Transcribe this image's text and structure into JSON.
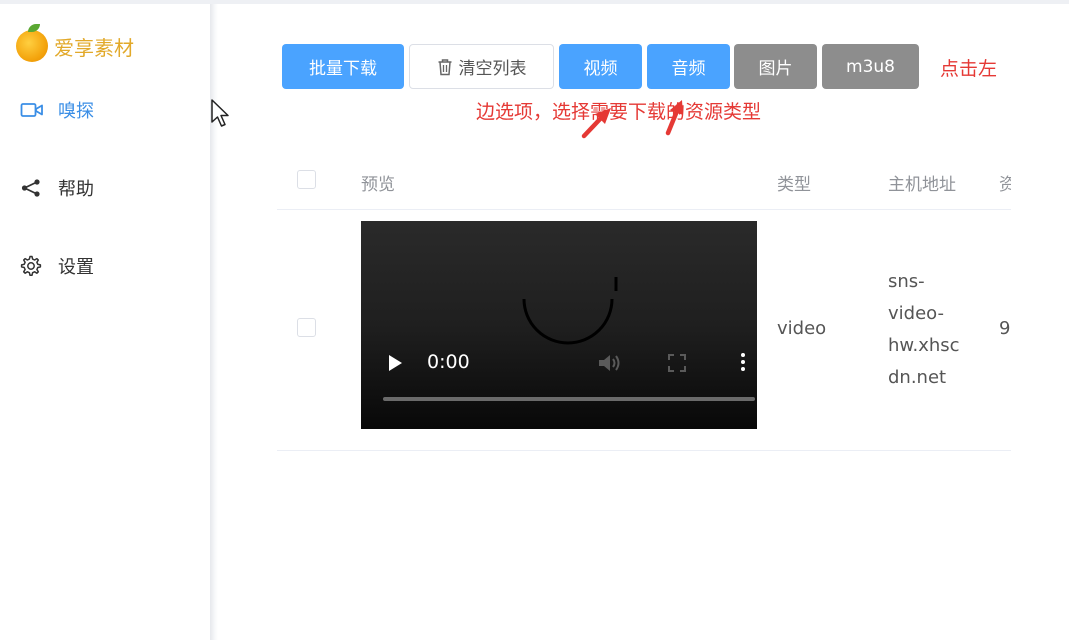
{
  "app": {
    "name": "爱享素材"
  },
  "sidebar": {
    "items": [
      {
        "label": "嗅探",
        "icon": "video-camera-icon",
        "active": true
      },
      {
        "label": "帮助",
        "icon": "share-icon",
        "active": false
      },
      {
        "label": "设置",
        "icon": "gear-icon",
        "active": false
      }
    ]
  },
  "toolbar": {
    "batch_download": "批量下载",
    "clear_list": "清空列表",
    "filters": [
      {
        "label": "视频",
        "active": true
      },
      {
        "label": "音频",
        "active": true
      },
      {
        "label": "图片",
        "active": false
      },
      {
        "label": "m3u8",
        "active": false
      }
    ]
  },
  "annotation": {
    "part1": "点击左",
    "part2": "边选项，选择需要下载的资源类型"
  },
  "table": {
    "headers": {
      "preview": "预览",
      "type": "类型",
      "host": "主机地址",
      "extra": "资"
    },
    "rows": [
      {
        "type": "video",
        "host_lines": [
          "sns-",
          "video-",
          "hw.xhsc",
          "dn.net"
        ],
        "extra": "9",
        "video": {
          "time": "0:00"
        }
      }
    ]
  },
  "colors": {
    "primary": "#4aa3ff",
    "gray": "#8d8d8d",
    "accent_red": "#e53935",
    "brand": "#e2a92a"
  }
}
